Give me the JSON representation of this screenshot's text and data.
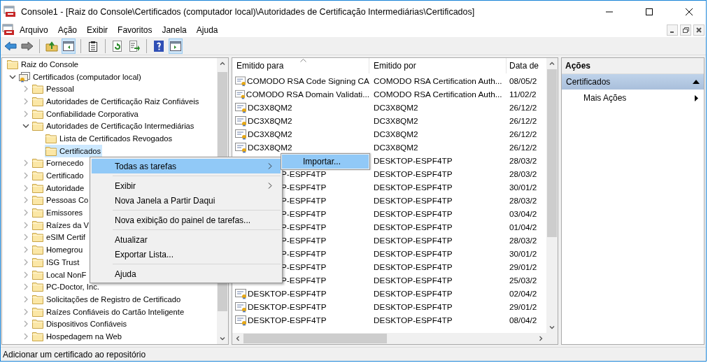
{
  "window": {
    "title": "Console1 - [Raiz do Console\\Certificados (computador local)\\Autoridades de Certificação Intermediárias\\Certificados]"
  },
  "menu_bar": [
    "Arquivo",
    "Ação",
    "Exibir",
    "Favoritos",
    "Janela",
    "Ajuda"
  ],
  "toolbar": [
    {
      "kind": "back",
      "pressed": false
    },
    {
      "kind": "forward",
      "pressed": false
    },
    {
      "kind": "sep"
    },
    {
      "kind": "up",
      "pressed": false
    },
    {
      "kind": "tree",
      "pressed": true
    },
    {
      "kind": "sep"
    },
    {
      "kind": "properties",
      "pressed": false
    },
    {
      "kind": "sep"
    },
    {
      "kind": "refresh",
      "pressed": false
    },
    {
      "kind": "export",
      "pressed": false
    },
    {
      "kind": "sep"
    },
    {
      "kind": "help",
      "pressed": false
    },
    {
      "kind": "actionpane",
      "pressed": true
    }
  ],
  "tree": [
    {
      "label": "Raiz do Console",
      "kind": "folder",
      "selected": false,
      "children": [
        {
          "label": "Certificados (computador local)",
          "kind": "store",
          "expanded": true,
          "selected": false,
          "children": [
            {
              "label": "Pessoal",
              "kind": "folder",
              "expanded": false,
              "selected": false
            },
            {
              "label": "Autoridades de Certificação Raiz Confiáveis",
              "kind": "folder",
              "expanded": false,
              "selected": false
            },
            {
              "label": "Confiabilidade Corporativa",
              "kind": "folder",
              "expanded": false,
              "selected": false
            },
            {
              "label": "Autoridades de Certificação Intermediárias",
              "kind": "folder",
              "expanded": true,
              "selected": false,
              "children": [
                {
                  "label": "Lista de Certificados Revogados",
                  "kind": "folder",
                  "selected": false
                },
                {
                  "label": "Certificados",
                  "kind": "folder",
                  "selected": true
                }
              ]
            },
            {
              "label": "Fornecedo",
              "kind": "folder",
              "expanded": false,
              "selected": false
            },
            {
              "label": "Certificado",
              "kind": "folder",
              "expanded": false,
              "selected": false
            },
            {
              "label": "Autoridade",
              "kind": "folder",
              "expanded": false,
              "selected": false
            },
            {
              "label": "Pessoas Co",
              "kind": "folder",
              "expanded": false,
              "selected": false
            },
            {
              "label": "Emissores",
              "kind": "folder",
              "expanded": false,
              "selected": false
            },
            {
              "label": "Raízes da V",
              "kind": "folder",
              "expanded": false,
              "selected": false
            },
            {
              "label": "eSIM Certif",
              "kind": "folder",
              "expanded": false,
              "selected": false
            },
            {
              "label": "Homegrou",
              "kind": "folder",
              "expanded": false,
              "selected": false
            },
            {
              "label": "ISG Trust",
              "kind": "folder",
              "expanded": false,
              "selected": false
            },
            {
              "label": "Local NonF",
              "kind": "folder",
              "expanded": false,
              "selected": false
            },
            {
              "label": "PC-Doctor, Inc.",
              "kind": "folder",
              "expanded": false,
              "selected": false
            },
            {
              "label": "Solicitações de Registro de Certificado",
              "kind": "folder",
              "expanded": false,
              "selected": false
            },
            {
              "label": "Raízes Confiáveis do Cartão Inteligente",
              "kind": "folder",
              "expanded": false,
              "selected": false
            },
            {
              "label": "Dispositivos Confiáveis",
              "kind": "folder",
              "expanded": false,
              "selected": false
            },
            {
              "label": "Hospedagem na Web",
              "kind": "folder",
              "expanded": false,
              "selected": false
            }
          ]
        }
      ]
    }
  ],
  "list": {
    "columns": [
      "Emitido para",
      "Emitido por",
      "Data de"
    ],
    "rows": [
      {
        "issued_to": "COMODO RSA Code Signing CA",
        "issued_by": "COMODO RSA Certification Auth...",
        "date": "08/05/2",
        "covered": false
      },
      {
        "issued_to": "COMODO RSA Domain Validati...",
        "issued_by": "COMODO RSA Certification Auth...",
        "date": "11/02/2",
        "covered": false
      },
      {
        "issued_to": "DC3X8QM2",
        "issued_by": "DC3X8QM2",
        "date": "26/12/2",
        "covered": false
      },
      {
        "issued_to": "DC3X8QM2",
        "issued_by": "DC3X8QM2",
        "date": "26/12/2",
        "covered": false
      },
      {
        "issued_to": "DC3X8QM2",
        "issued_by": "DC3X8QM2",
        "date": "26/12/2",
        "covered": false
      },
      {
        "issued_to": "DC3X8QM2",
        "issued_by": "DC3X8QM2",
        "date": "26/12/2",
        "covered": false
      },
      {
        "issued_by": "DESKTOP-ESPF4TP",
        "date": "28/03/2",
        "covered": true
      },
      {
        "issued_to": "P-ESPF4TP",
        "issued_by": "DESKTOP-ESPF4TP",
        "date": "28/03/2",
        "covered": true
      },
      {
        "issued_to": "P-ESPF4TP",
        "issued_by": "DESKTOP-ESPF4TP",
        "date": "30/01/2",
        "covered": true
      },
      {
        "issued_to": "P-ESPF4TP",
        "issued_by": "DESKTOP-ESPF4TP",
        "date": "28/03/2",
        "covered": true
      },
      {
        "issued_to": "P-ESPF4TP",
        "issued_by": "DESKTOP-ESPF4TP",
        "date": "03/04/2",
        "covered": true
      },
      {
        "issued_to": "P-ESPF4TP",
        "issued_by": "DESKTOP-ESPF4TP",
        "date": "01/04/2",
        "covered": true
      },
      {
        "issued_to": "P-ESPF4TP",
        "issued_by": "DESKTOP-ESPF4TP",
        "date": "28/03/2",
        "covered": true
      },
      {
        "issued_to": "P-ESPF4TP",
        "issued_by": "DESKTOP-ESPF4TP",
        "date": "30/01/2",
        "covered": true
      },
      {
        "issued_to": "P-ESPF4TP",
        "issued_by": "DESKTOP-ESPF4TP",
        "date": "29/01/2",
        "covered": true
      },
      {
        "issued_to": "P-ESPF4TP",
        "issued_by": "DESKTOP-ESPF4TP",
        "date": "25/03/2",
        "covered": true
      },
      {
        "issued_to": "DESKTOP-ESPF4TP",
        "issued_by": "DESKTOP-ESPF4TP",
        "date": "02/04/2",
        "covered": false
      },
      {
        "issued_to": "DESKTOP-ESPF4TP",
        "issued_by": "DESKTOP-ESPF4TP",
        "date": "29/01/2",
        "covered": false
      },
      {
        "issued_to": "DESKTOP-ESPF4TP",
        "issued_by": "DESKTOP-ESPF4TP",
        "date": "08/04/2",
        "covered": false
      }
    ]
  },
  "actions": {
    "title": "Ações",
    "sections": [
      {
        "title": "Certificados",
        "expanded": true,
        "items": [
          {
            "label": "Mais Ações",
            "submenu": true
          }
        ]
      }
    ]
  },
  "context_menu": {
    "items": [
      {
        "kind": "item",
        "label": "Todas as tarefas",
        "submenu": true,
        "selected": true
      },
      {
        "kind": "separator"
      },
      {
        "kind": "item",
        "label": "Exibir",
        "submenu": true,
        "selected": false
      },
      {
        "kind": "item",
        "label": "Nova Janela a Partir Daqui",
        "submenu": false,
        "selected": false
      },
      {
        "kind": "separator"
      },
      {
        "kind": "item",
        "label": "Nova exibição do painel de tarefas...",
        "submenu": false,
        "selected": false
      },
      {
        "kind": "separator"
      },
      {
        "kind": "item",
        "label": "Atualizar",
        "submenu": false,
        "selected": false
      },
      {
        "kind": "item",
        "label": "Exportar Lista...",
        "submenu": false,
        "selected": false
      },
      {
        "kind": "separator"
      },
      {
        "kind": "item",
        "label": "Ajuda",
        "submenu": false,
        "selected": false
      }
    ]
  },
  "submenu": {
    "items": [
      {
        "label": "Importar...",
        "selected": true
      }
    ]
  },
  "status_bar": "Adicionar um certificado ao repositório"
}
